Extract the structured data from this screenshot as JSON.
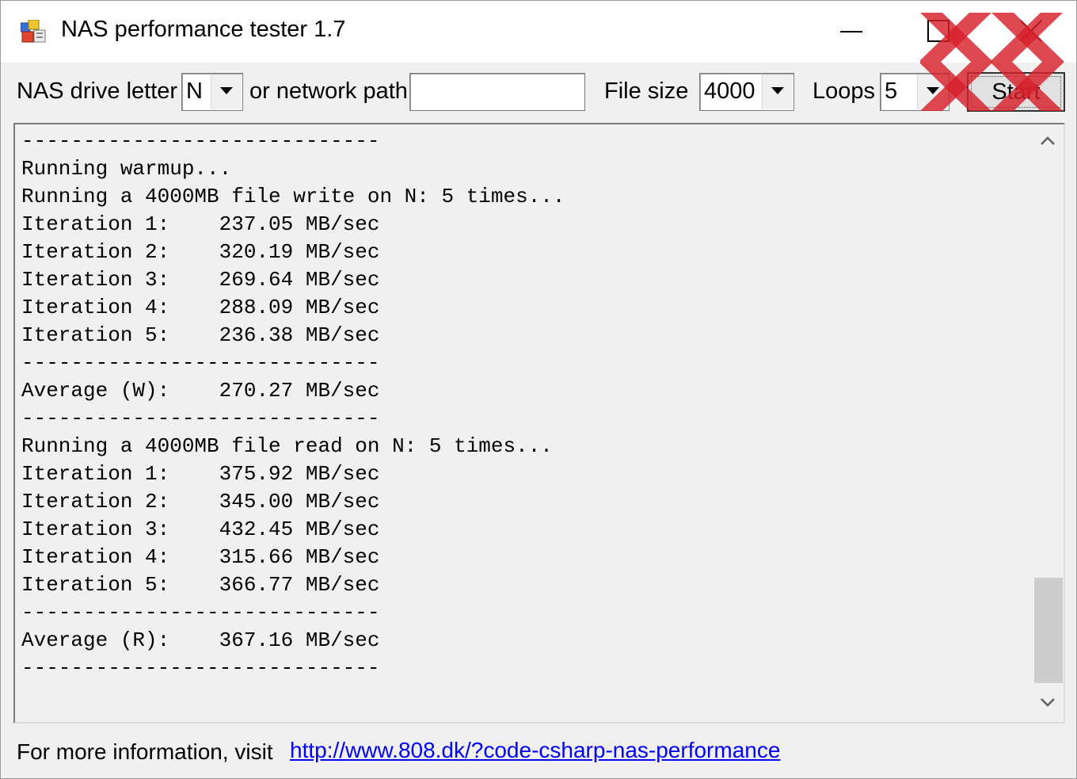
{
  "window": {
    "title": "NAS performance tester 1.7"
  },
  "toolbar": {
    "drive_letter_label": "NAS drive letter",
    "drive_letter_value": "N",
    "network_path_label": "or network path",
    "network_path_value": "",
    "file_size_label": "File size",
    "file_size_value": "4000",
    "loops_label": "Loops",
    "loops_value": "5",
    "start_label": "Start"
  },
  "output": {
    "lines": [
      "-----------------------------",
      "Running warmup...",
      "Running a 4000MB file write on N: 5 times...",
      "Iteration 1:    237.05 MB/sec",
      "Iteration 2:    320.19 MB/sec",
      "Iteration 3:    269.64 MB/sec",
      "Iteration 4:    288.09 MB/sec",
      "Iteration 5:    236.38 MB/sec",
      "-----------------------------",
      "Average (W):    270.27 MB/sec",
      "-----------------------------",
      "Running a 4000MB file read on N: 5 times...",
      "Iteration 1:    375.92 MB/sec",
      "Iteration 2:    345.00 MB/sec",
      "Iteration 3:    432.45 MB/sec",
      "Iteration 4:    315.66 MB/sec",
      "Iteration 5:    366.77 MB/sec",
      "-----------------------------",
      "Average (R):    367.16 MB/sec",
      "-----------------------------"
    ],
    "scroll": {
      "position": 0.99,
      "visible_fraction": 0.2
    }
  },
  "footer": {
    "info_text": "For more information, visit",
    "link_text": "http://www.808.dk/?code-csharp-nas-performance"
  },
  "icons": {
    "app": "app-icon",
    "minimize": "minimize-icon",
    "maximize": "maximize-icon",
    "close": "close-icon",
    "dropdown": "chevron-down-icon",
    "scroll_up": "chevron-up-icon",
    "scroll_down": "chevron-down-icon",
    "watermark": "watermark-logo"
  },
  "colors": {
    "window_bg": "#f0f0f0",
    "link": "#0000ff",
    "watermark": "#d6202b"
  }
}
